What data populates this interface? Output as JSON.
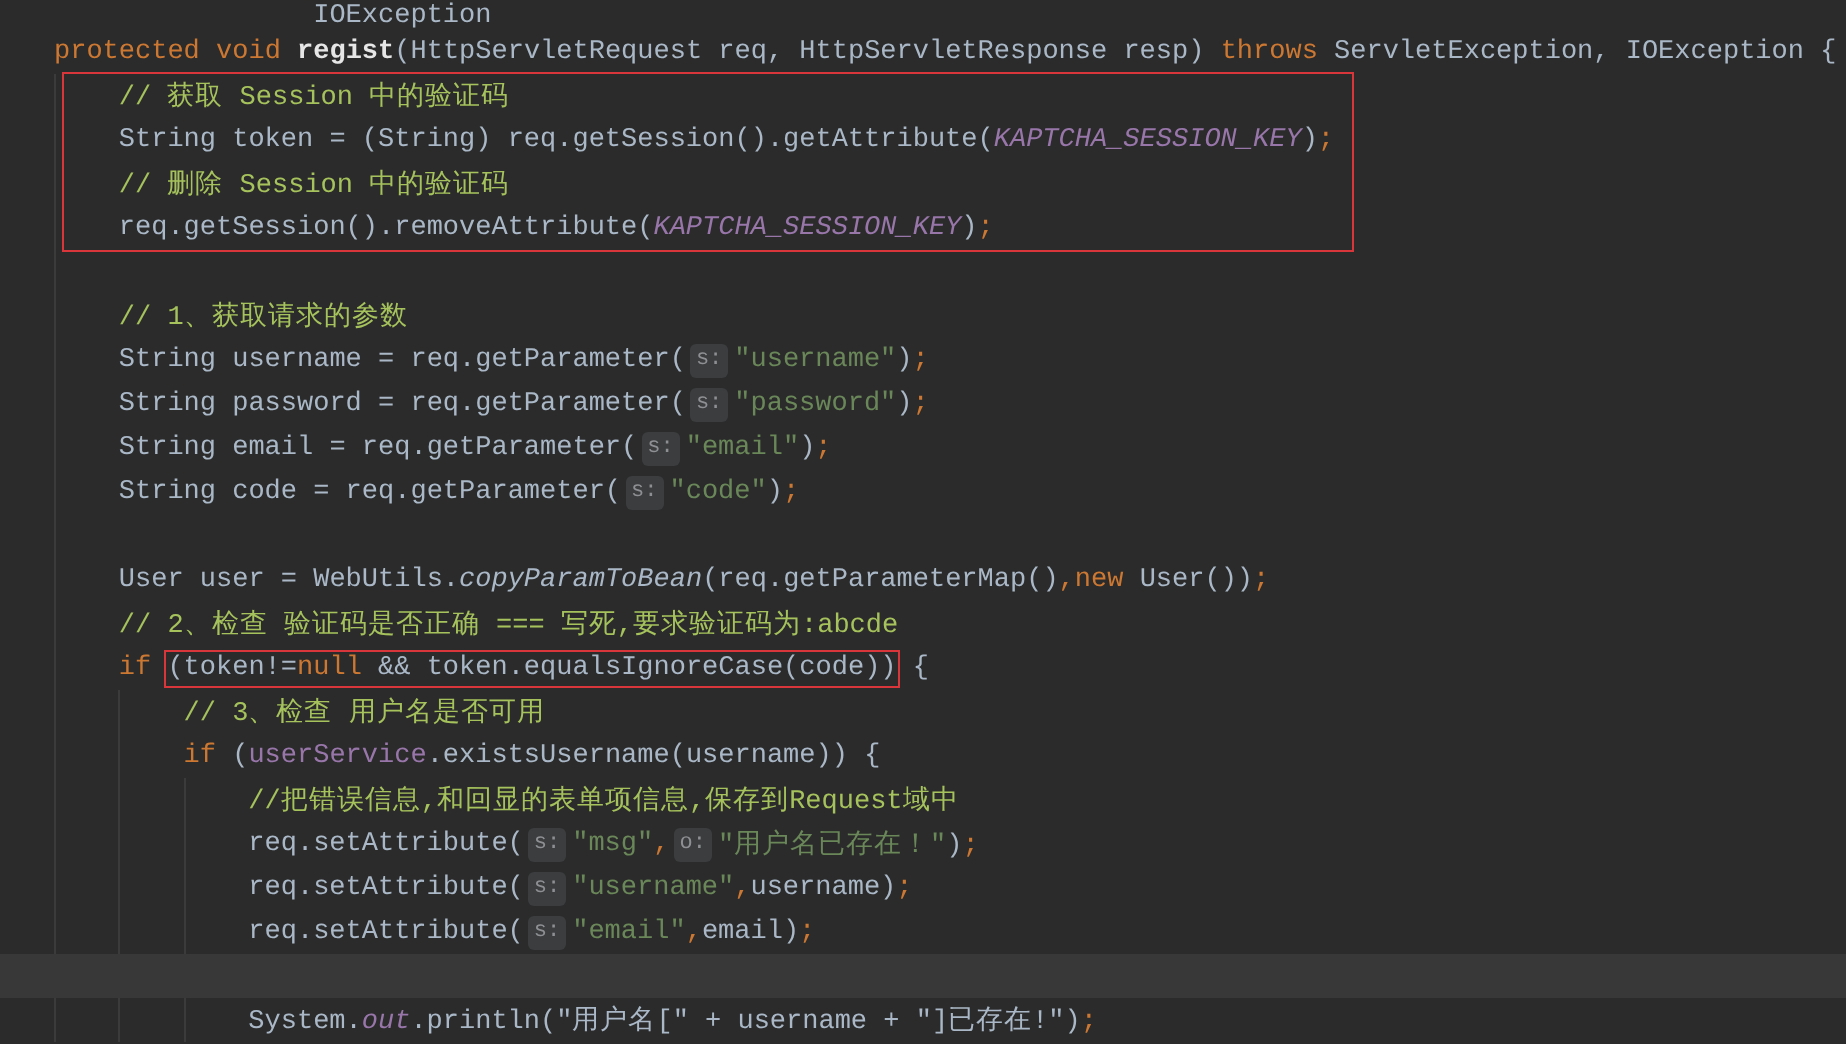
{
  "editor": {
    "lines": [
      {
        "kind": "continuation",
        "current": false,
        "tokens": [
          {
            "text": "IOException",
            "kind": "plain"
          }
        ]
      },
      {
        "kind": "code",
        "current": false,
        "tokens": [
          {
            "text": "protected void ",
            "kind": "kw"
          },
          {
            "text": "regist",
            "kind": "fn"
          },
          {
            "text": "(HttpServletRequest req, HttpServletResponse resp) ",
            "kind": "plain"
          },
          {
            "text": "throws ",
            "kind": "kw"
          },
          {
            "text": "ServletException, IOException {",
            "kind": "plain"
          }
        ],
        "children": [
          {
            "kind": "boxed",
            "children": [
              {
                "kind": "code",
                "current": false,
                "tokens": [
                  {
                    "text": "// 获取 Session 中的验证码",
                    "kind": "comment"
                  }
                ]
              },
              {
                "kind": "code",
                "current": false,
                "tokens": [
                  {
                    "text": "String token = (String) req.getSession().getAttribute(",
                    "kind": "plain"
                  },
                  {
                    "text": "KAPTCHA_SESSION_KEY",
                    "kind": "const"
                  },
                  {
                    "text": ")",
                    "kind": "plain"
                  },
                  {
                    "text": ";",
                    "kind": "punct"
                  }
                ]
              },
              {
                "kind": "code",
                "current": false,
                "tokens": [
                  {
                    "text": "// 删除 Session 中的验证码",
                    "kind": "comment"
                  }
                ]
              },
              {
                "kind": "code",
                "current": false,
                "tokens": [
                  {
                    "text": "req.getSession().removeAttribute(",
                    "kind": "plain"
                  },
                  {
                    "text": "KAPTCHA_SESSION_KEY",
                    "kind": "const"
                  },
                  {
                    "text": ")",
                    "kind": "plain"
                  },
                  {
                    "text": ";",
                    "kind": "punct"
                  }
                ]
              }
            ]
          },
          {
            "kind": "code",
            "current": false
          },
          {
            "kind": "code",
            "current": false,
            "tokens": [
              {
                "text": "// 1、获取请求的参数",
                "kind": "comment"
              }
            ]
          },
          {
            "kind": "code",
            "current": false,
            "tokens": [
              {
                "text": "String username = req.getParameter(",
                "kind": "plain"
              },
              {
                "text": "s:",
                "kind": "hint"
              },
              {
                "text": "\"username\"",
                "kind": "str"
              },
              {
                "text": ")",
                "kind": "plain"
              },
              {
                "text": ";",
                "kind": "punct"
              }
            ]
          },
          {
            "kind": "code",
            "current": false,
            "tokens": [
              {
                "text": "String password = req.getParameter(",
                "kind": "plain"
              },
              {
                "text": "s:",
                "kind": "hint"
              },
              {
                "text": "\"password\"",
                "kind": "str"
              },
              {
                "text": ")",
                "kind": "plain"
              },
              {
                "text": ";",
                "kind": "punct"
              }
            ]
          },
          {
            "kind": "code",
            "current": false,
            "tokens": [
              {
                "text": "String email = req.getParameter(",
                "kind": "plain"
              },
              {
                "text": "s:",
                "kind": "hint"
              },
              {
                "text": "\"email\"",
                "kind": "str"
              },
              {
                "text": ")",
                "kind": "plain"
              },
              {
                "text": ";",
                "kind": "punct"
              }
            ]
          },
          {
            "kind": "code",
            "current": false,
            "tokens": [
              {
                "text": "String code = req.getParameter(",
                "kind": "plain"
              },
              {
                "text": "s:",
                "kind": "hint"
              },
              {
                "text": "\"code\"",
                "kind": "str"
              },
              {
                "text": ")",
                "kind": "plain"
              },
              {
                "text": ";",
                "kind": "punct"
              }
            ]
          },
          {
            "kind": "code",
            "current": false
          },
          {
            "kind": "code",
            "current": false,
            "tokens": [
              {
                "text": "User user = WebUtils.",
                "kind": "plain"
              },
              {
                "text": "copyParamToBean",
                "kind": "static"
              },
              {
                "text": "(req.getParameterMap()",
                "kind": "plain"
              },
              {
                "text": ",",
                "kind": "punct"
              },
              {
                "text": "new ",
                "kind": "kw"
              },
              {
                "text": "User())",
                "kind": "plain"
              },
              {
                "text": ";",
                "kind": "punct"
              }
            ]
          },
          {
            "kind": "code",
            "current": false,
            "tokens": [
              {
                "text": "// 2、检查 验证码是否正确 === 写死,要求验证码为:abcde",
                "kind": "comment"
              }
            ]
          },
          {
            "kind": "code",
            "current": false,
            "tokens": [
              {
                "text": "if ",
                "kind": "kw"
              },
              {
                "kind": "boxed",
                "tokens": [
                  {
                    "text": "(token!=",
                    "kind": "plain"
                  },
                  {
                    "text": "null",
                    "kind": "kw"
                  },
                  {
                    "text": " && token.equalsIgnoreCase(code))",
                    "kind": "plain"
                  }
                ]
              },
              {
                "text": " {",
                "kind": "plain"
              }
            ],
            "children": [
              {
                "kind": "code",
                "current": false,
                "tokens": [
                  {
                    "text": "// 3、检查 用户名是否可用",
                    "kind": "comment"
                  }
                ]
              },
              {
                "kind": "code",
                "current": false,
                "tokens": [
                  {
                    "text": "if ",
                    "kind": "kw"
                  },
                  {
                    "text": "(",
                    "kind": "plain"
                  },
                  {
                    "text": "userService",
                    "kind": "field"
                  },
                  {
                    "text": ".existsUsername(username)) {",
                    "kind": "plain"
                  }
                ],
                "children": [
                  {
                    "kind": "code",
                    "current": false,
                    "tokens": [
                      {
                        "text": "//把错误信息,和回显的表单项信息,保存到Request域中",
                        "kind": "comment"
                      }
                    ]
                  },
                  {
                    "kind": "code",
                    "current": false,
                    "tokens": [
                      {
                        "text": "req.setAttribute(",
                        "kind": "plain"
                      },
                      {
                        "text": "s:",
                        "kind": "hint"
                      },
                      {
                        "text": "\"msg\"",
                        "kind": "str"
                      },
                      {
                        "text": ",",
                        "kind": "punct"
                      },
                      {
                        "text": "o:",
                        "kind": "hint"
                      },
                      {
                        "text": "\"用户名已存在！\"",
                        "kind": "str"
                      },
                      {
                        "text": ")",
                        "kind": "plain"
                      },
                      {
                        "text": ";",
                        "kind": "punct"
                      }
                    ]
                  },
                  {
                    "kind": "code",
                    "current": false,
                    "tokens": [
                      {
                        "text": "req.setAttribute(",
                        "kind": "plain"
                      },
                      {
                        "text": "s:",
                        "kind": "hint"
                      },
                      {
                        "text": "\"username\"",
                        "kind": "str"
                      },
                      {
                        "text": ",",
                        "kind": "punct"
                      },
                      {
                        "text": "username)",
                        "kind": "plain"
                      },
                      {
                        "text": ";",
                        "kind": "punct"
                      }
                    ]
                  },
                  {
                    "kind": "code",
                    "current": false,
                    "tokens": [
                      {
                        "text": "req.setAttribute(",
                        "kind": "plain"
                      },
                      {
                        "text": "s:",
                        "kind": "hint"
                      },
                      {
                        "text": "\"email\"",
                        "kind": "str"
                      },
                      {
                        "text": ",",
                        "kind": "punct"
                      },
                      {
                        "text": "email)",
                        "kind": "plain"
                      },
                      {
                        "text": ";",
                        "kind": "punct"
                      }
                    ]
                  },
                  {
                    "kind": "code",
                    "current": true
                  },
                  {
                    "kind": "code",
                    "current": false,
                    "tokens": [
                      {
                        "text": "System.",
                        "kind": "plain"
                      },
                      {
                        "text": "out",
                        "kind": "const"
                      },
                      {
                        "text": ".println(\"用户名[\" + username + \"]已存在!\")",
                        "kind": "plain"
                      },
                      {
                        "text": ";",
                        "kind": "punct"
                      }
                    ]
                  }
                ]
              }
            ]
          }
        ]
      }
    ]
  }
}
